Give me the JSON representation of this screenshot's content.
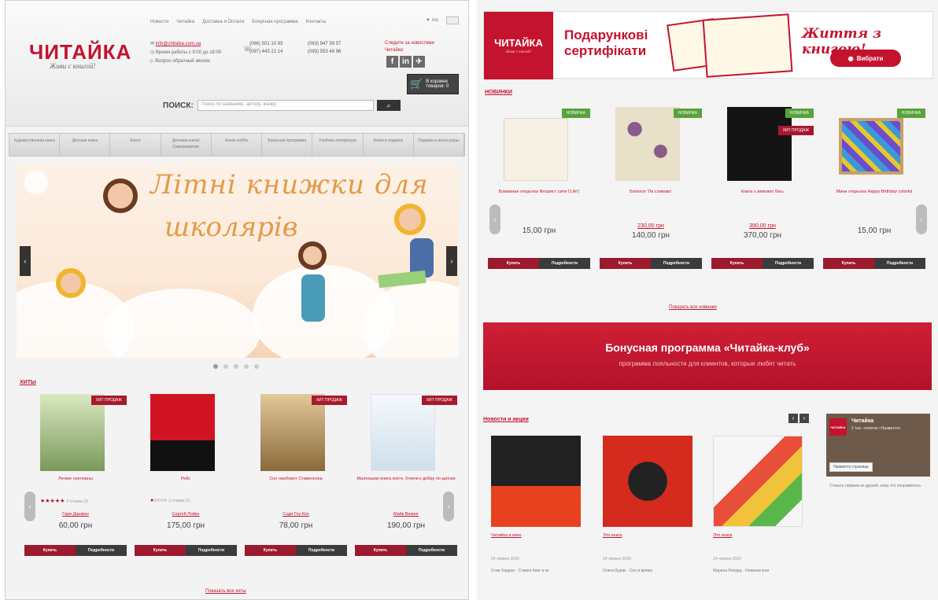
{
  "left": {
    "header": {
      "logo": "ЧИТАЙКА",
      "slogan": "Живи с книгой!",
      "topnav": [
        "Новости",
        "Читайка",
        "Доставка и Оплата",
        "Бонусная программа",
        "Контакты"
      ],
      "lang": "▼ rus",
      "email": "info@chitaika.com.ua",
      "contact_lines": [
        "Время работы с 9:00 до 18:00",
        "Вопрос-обратный звонок"
      ],
      "phones": [
        "(066) 501 10 93",
        "(063) 947 39 57",
        "(097) 443 22 14",
        "(093) 553 48 96"
      ],
      "social_text": "Следите за новостями Читайки:",
      "social_icons": [
        "f",
        "in",
        "✈"
      ],
      "cart_label": "В корзине товаров: 0",
      "search_label": "ПОИСК:",
      "search_placeholder": "Поиск по названию, автору, жанру",
      "search_button_icon": "search-icon"
    },
    "menu": [
      "Художественная книга",
      "Детская книга",
      "Книги",
      "Деловая книга/Саморазвитие",
      "Книги-хобби",
      "Бонусная программа",
      "Учебная литература",
      "Книги в подарок",
      "Подарки и аксессуары"
    ],
    "banner": {
      "line1": "Літні книжки для",
      "line2": "школярів"
    },
    "slider_dots": 5,
    "hits_title": "ХИТЫ",
    "products": [
      {
        "name": "Легкие ноктюрны",
        "badge": "ХИТ ПРОДАЖ",
        "stars": "★★★★★",
        "reviews": "2 отзыва (2)",
        "author": "Гари Дашван",
        "price": "60,00 грн",
        "cover": "#9fb87a"
      },
      {
        "name": "Рейс",
        "badge": "",
        "stars": "●○○○○",
        "reviews": "2 отзыва (1)",
        "author": "Сергей Лойко",
        "price": "175,00 грн",
        "cover": "#b8101e"
      },
      {
        "name": "Сон наоборот Стивенсона",
        "badge": "ХИТ ПРОДАЖ",
        "stars": "",
        "reviews": "",
        "author": "Сэди Гоу-Кох",
        "price": "78,00 грн",
        "cover": "#c89a56"
      },
      {
        "name": "Маленькая книга хюгге. Ключи к добру по-датски",
        "badge": "ХИТ ПРОДАЖ",
        "stars": "",
        "reviews": "",
        "author": "Майк Викинг",
        "price": "190,00 грн",
        "cover": "#eaf1f6"
      }
    ],
    "buy_label": "Купить",
    "details_label": "Подробности",
    "show_all": "Показать все хиты"
  },
  "right": {
    "cert": {
      "logo": "ЧИТАЙКА",
      "logo_sub": "Живи с книгой!",
      "line1": "Подарункові",
      "line2": "сертифікати",
      "slogan": "Життя з книгою!",
      "button": "Вибрати"
    },
    "new_title": "НОВИНКИ",
    "new_products": [
      {
        "name": "Бумажная открытка Флорист сити ('Life')",
        "badge": "НОВИНКА",
        "old": "",
        "price": "15,00 грн",
        "cover": "#f2eadf"
      },
      {
        "name": "Блокнот 'Ла сливово'",
        "badge": "НОВИНКА",
        "old": "230,00 грн",
        "price": "140,00 грн",
        "cover": "#7a4a3a"
      },
      {
        "name": "Книга з зимових бать",
        "badge": "НОВИНКА",
        "badge2": "ХИТ ПРОДАЖ",
        "old": "390,00 грн",
        "price": "370,00 грн",
        "cover": "#141414"
      },
      {
        "name": "Мини открытка Happy Birthday colorful",
        "badge": "НОВИНКА",
        "old": "",
        "price": "15,00 грн",
        "cover": "#7b5bd6"
      }
    ],
    "buy_label": "Купить",
    "details_label": "Подробности",
    "show_all": "Показать все новинки",
    "bonus_title": "Бонусная программа «Читайка-клуб»",
    "bonus_sub": "программа лояльности для клиентов, которые любят читать",
    "news_title": "Новости и акции",
    "news": [
      {
        "title": "Читайка и кино",
        "date": "24 червня 2020",
        "tags": "Стив Хардли · Стивен Кинг и ко",
        "img": "#222222"
      },
      {
        "title": "Это книга",
        "date": "24 червня 2020",
        "tags": "Олеся Бурак · Сон и время",
        "img": "#d52b1e"
      },
      {
        "title": "Это книга",
        "date": "24 червня 2020",
        "tags": "Марина Ричард · Новинки книг",
        "img": "#f6f6f6"
      }
    ],
    "fb": {
      "name": "Читайка",
      "likes": "2 тыс. отметок «Нравится»",
      "button": "Нравится странице",
      "text": "Станьте первым из друзей, кому это понравилось."
    }
  }
}
